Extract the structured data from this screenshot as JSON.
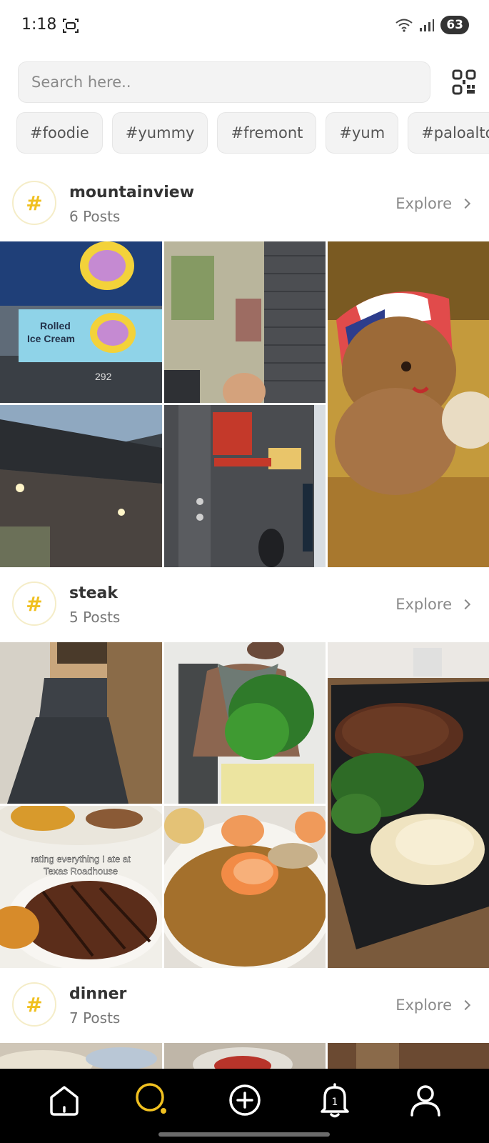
{
  "status": {
    "time": "1:18",
    "battery": "63"
  },
  "search": {
    "placeholder": "Search here.."
  },
  "tags": [
    "#foodie",
    "#yummy",
    "#fremont",
    "#yum",
    "#paloalto"
  ],
  "sections": [
    {
      "name": "mountainview",
      "count": "6 Posts",
      "explore": "Explore"
    },
    {
      "name": "steak",
      "count": "5 Posts",
      "explore": "Explore"
    },
    {
      "name": "dinner",
      "count": "7 Posts",
      "explore": "Explore"
    }
  ],
  "photos": {
    "store_sign": {
      "text1": "Rolled",
      "text2": "Ice Cream",
      "number": "292"
    },
    "caption": {
      "line1": "rating everything I ate at",
      "line2": "Texas Roadhouse"
    }
  },
  "bottom_nav": {
    "items": [
      "home-icon",
      "search-icon",
      "add-icon",
      "notifications-icon",
      "profile-icon"
    ],
    "notification_count": "1",
    "active_color": "#f0c020"
  }
}
